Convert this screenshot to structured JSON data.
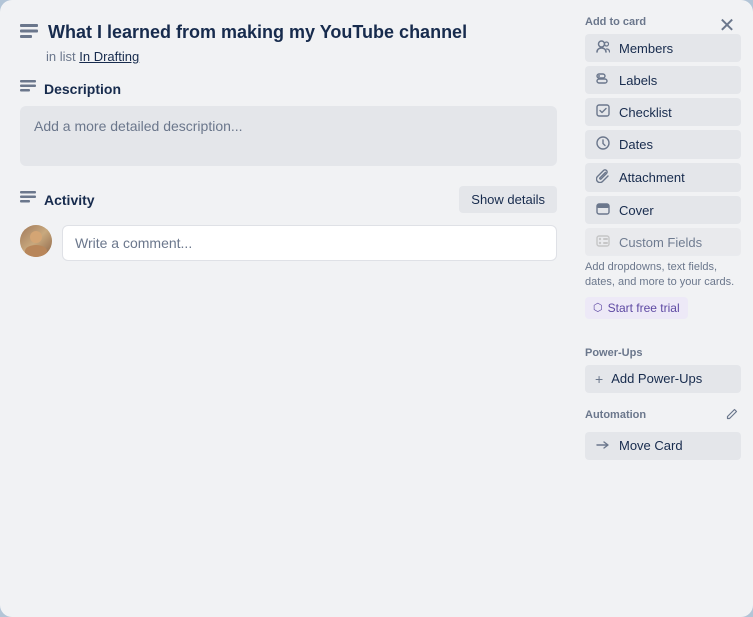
{
  "modal": {
    "close_label": "✕"
  },
  "card": {
    "icon": "▭",
    "title": "What I learned from making my YouTube channel",
    "subtitle_prefix": "in list",
    "subtitle_link": "In Drafting"
  },
  "description": {
    "section_label": "Description",
    "section_icon": "☰",
    "placeholder": "Add a more detailed description..."
  },
  "activity": {
    "section_label": "Activity",
    "section_icon": "☰",
    "show_details_label": "Show details",
    "comment_placeholder": "Write a comment..."
  },
  "sidebar": {
    "add_to_card_label": "Add to card",
    "buttons": [
      {
        "id": "members",
        "icon": "👤",
        "label": "Members"
      },
      {
        "id": "labels",
        "icon": "🏷",
        "label": "Labels"
      },
      {
        "id": "checklist",
        "icon": "☑",
        "label": "Checklist"
      },
      {
        "id": "dates",
        "icon": "🕐",
        "label": "Dates"
      },
      {
        "id": "attachment",
        "icon": "📎",
        "label": "Attachment"
      },
      {
        "id": "cover",
        "icon": "▬",
        "label": "Cover"
      }
    ],
    "custom_fields": {
      "label": "Custom Fields",
      "description": "Add dropdowns, text fields, dates, and more to your cards.",
      "trial_button": "Start free trial",
      "trial_icon": "⬡"
    },
    "power_ups": {
      "label": "Power-Ups",
      "add_label": "Add Power-Ups",
      "plus_icon": "+"
    },
    "automation": {
      "label": "Automation",
      "edit_icon": "✏",
      "move_card_label": "Move Card",
      "arrow_icon": "→"
    }
  }
}
